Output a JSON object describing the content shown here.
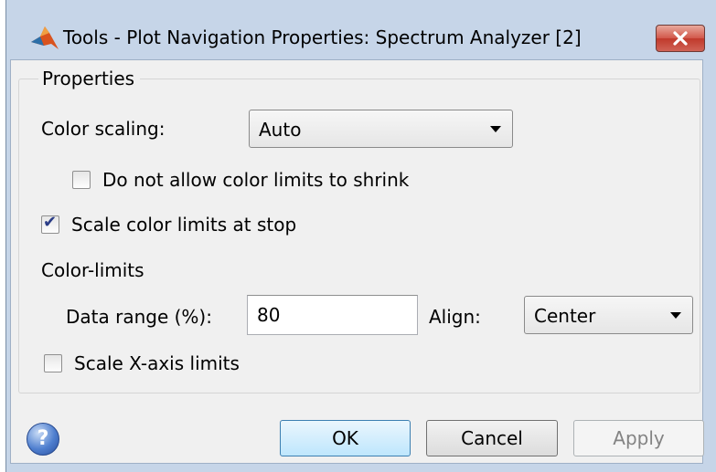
{
  "window": {
    "title": "Tools - Plot Navigation Properties: Spectrum Analyzer [2]",
    "app_icon": "matlab-logo-icon",
    "close_icon": "close-icon"
  },
  "properties": {
    "group_title": "Properties",
    "color_scaling": {
      "label": "Color scaling:",
      "selected": "Auto"
    },
    "no_shrink": {
      "label": "Do not allow color limits to shrink",
      "checked": false
    },
    "scale_at_stop": {
      "label": "Scale color limits at stop",
      "checked": true
    },
    "color_limits": {
      "heading": "Color-limits",
      "data_range_label": "Data range (%):",
      "data_range_value": "80",
      "align_label": "Align:",
      "align_selected": "Center"
    },
    "scale_x": {
      "label": "Scale X-axis limits",
      "checked": false
    }
  },
  "footer": {
    "help_icon": "help-icon",
    "help_glyph": "?",
    "ok_label": "OK",
    "cancel_label": "Cancel",
    "apply_label": "Apply"
  }
}
